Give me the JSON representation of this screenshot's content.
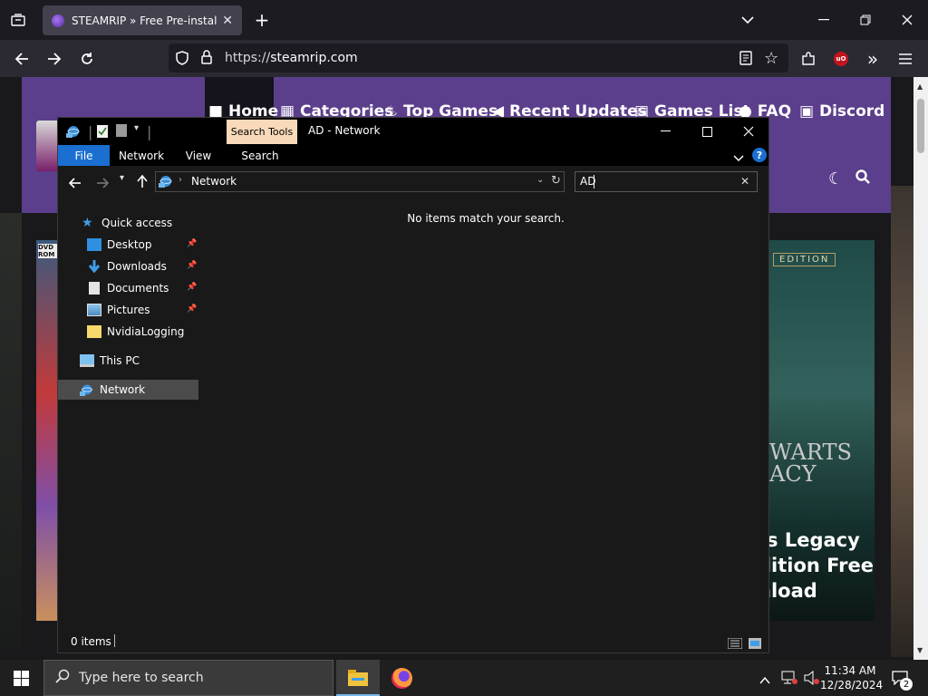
{
  "browser": {
    "tab_title": "STEAMRIP » Free Pre-installed Steam Games",
    "url_scheme": "https://",
    "url_host": "steamrip.com",
    "addon_badge": "uO"
  },
  "site": {
    "menu": [
      "Home",
      "Categories",
      "Top Games",
      "Recent Updates",
      "Games List",
      "FAQ",
      "Discord"
    ],
    "banner_badge_left": "DVD ROM",
    "banner_edition": "EDITION",
    "poster_art_text": "WARTS\nACY",
    "game_title_lines": [
      "ts Legacy",
      "dition Free",
      "nload"
    ]
  },
  "explorer": {
    "contextual_tab": "Search Tools",
    "window_title": "AD - Network",
    "ribbon_tabs": [
      "File",
      "Network",
      "View",
      "Search"
    ],
    "address_path": "Network",
    "search_query": "AD",
    "empty_message": "No items match your search.",
    "nav": {
      "quick_access": "Quick access",
      "items": [
        "Desktop",
        "Downloads",
        "Documents",
        "Pictures",
        "NvidiaLogging"
      ],
      "this_pc": "This PC",
      "network": "Network"
    },
    "status": "0 items"
  },
  "taskbar": {
    "search_placeholder": "Type here to search",
    "time": "11:34 AM",
    "date": "12/28/2024",
    "notification_count": "2"
  },
  "colors": {
    "site_header": "#5b3f8c",
    "file_tab": "#1a6fd0",
    "search_tools": "#f8d9b9",
    "help": "#1a6fd0"
  }
}
